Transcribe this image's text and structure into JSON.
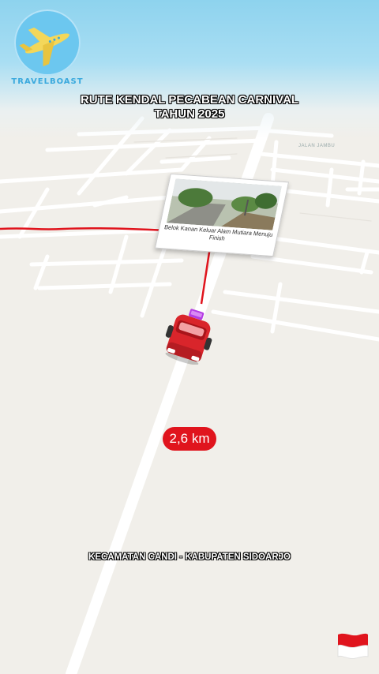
{
  "logo": {
    "text": "TRAVELBOAST"
  },
  "title": {
    "line1": "RUTE KENDAL PECABEAN CARNIVAL",
    "line2": "TAHUN 2025"
  },
  "map": {
    "street_label": "JALAN JAMBU",
    "route_color": "#e0141d",
    "road_color": "#ffffff",
    "land_color": "#f1efea"
  },
  "photo_card": {
    "caption": "Belok Kanan Keluar Alam Mutiara Menuju Finish"
  },
  "distance": {
    "label": "2,6 km"
  },
  "location": {
    "label": "KECAMATAN CANDI - KABUPATEN SIDOARJO"
  },
  "flag": {
    "icon": "indonesia-flag-icon",
    "top_color": "#e0141d",
    "bottom_color": "#ffffff"
  }
}
